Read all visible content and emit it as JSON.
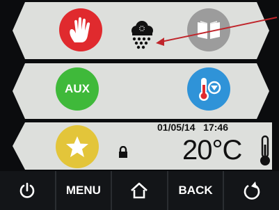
{
  "rows": [
    {
      "left_icon": "hand-stop-icon",
      "right_icon": "book-icon"
    },
    {
      "left_label": "AUX",
      "right_icon": "thermometer-down-icon"
    },
    {
      "left_icon": "star-icon"
    }
  ],
  "status": {
    "weather_icon": "snow-cloud-icon",
    "lock_icon": "lock-icon",
    "date": "01/05/14",
    "time": "17:46",
    "temperature": "20°C"
  },
  "bottom_bar": {
    "power_icon": "power-icon",
    "menu_label": "MENU",
    "home_icon": "home-icon",
    "back_label": "BACK",
    "refresh_icon": "refresh-icon"
  },
  "colors": {
    "stop": "#e02a2e",
    "book": "#9c9c9c",
    "aux": "#3fb93a",
    "thermo": "#2f93d8",
    "star": "#e3c53a",
    "band": "#dcdedb"
  }
}
